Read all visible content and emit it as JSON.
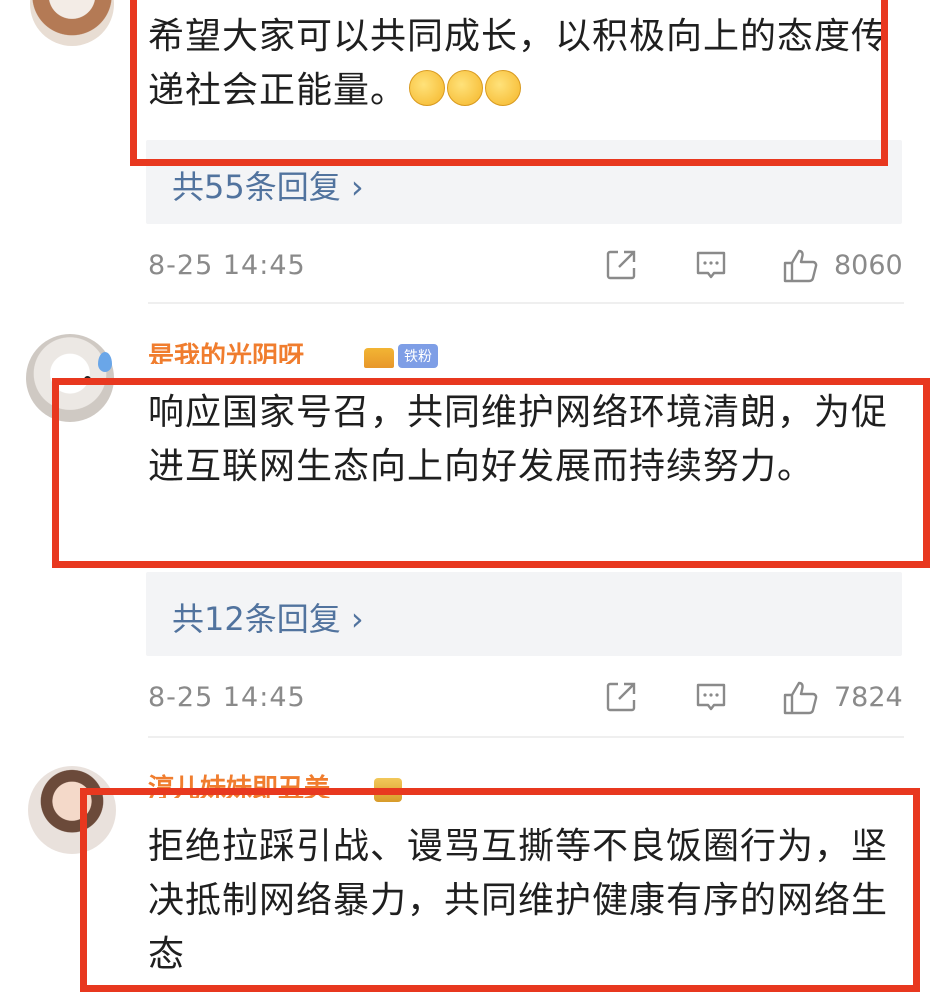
{
  "comments": [
    {
      "text": "希望大家可以共同成长，以积极向上的态度传递社会正能量。",
      "emoji_icons": [
        "blush-emoji-icon",
        "blush-emoji-icon",
        "blush-emoji-icon"
      ],
      "replies_label": "共55条回复",
      "timestamp": "8-25 14:45",
      "likes": "8060"
    },
    {
      "username": "是我的光阴呀",
      "badge": "铁粉",
      "text": "响应国家号召，共同维护网络环境清朗，为促进互联网生态向上向好发展而持续努力。",
      "replies_label": "共12条回复",
      "timestamp": "8-25 14:45",
      "likes": "7824"
    },
    {
      "username": "淳儿妹妹即丑美",
      "text": "拒绝拉踩引战、谩骂互撕等不良饭圈行为，坚决抵制网络暴力，共同维护健康有序的网络生态"
    }
  ],
  "icons": {
    "share": "share-icon",
    "comment": "comment-icon",
    "like": "thumbs-up-icon",
    "reply_arrow": "chevron-right-icon"
  },
  "colors": {
    "highlight": "#e8381f",
    "username": "#f07d2e",
    "link": "#51739e",
    "meta": "#8a8a8a"
  }
}
